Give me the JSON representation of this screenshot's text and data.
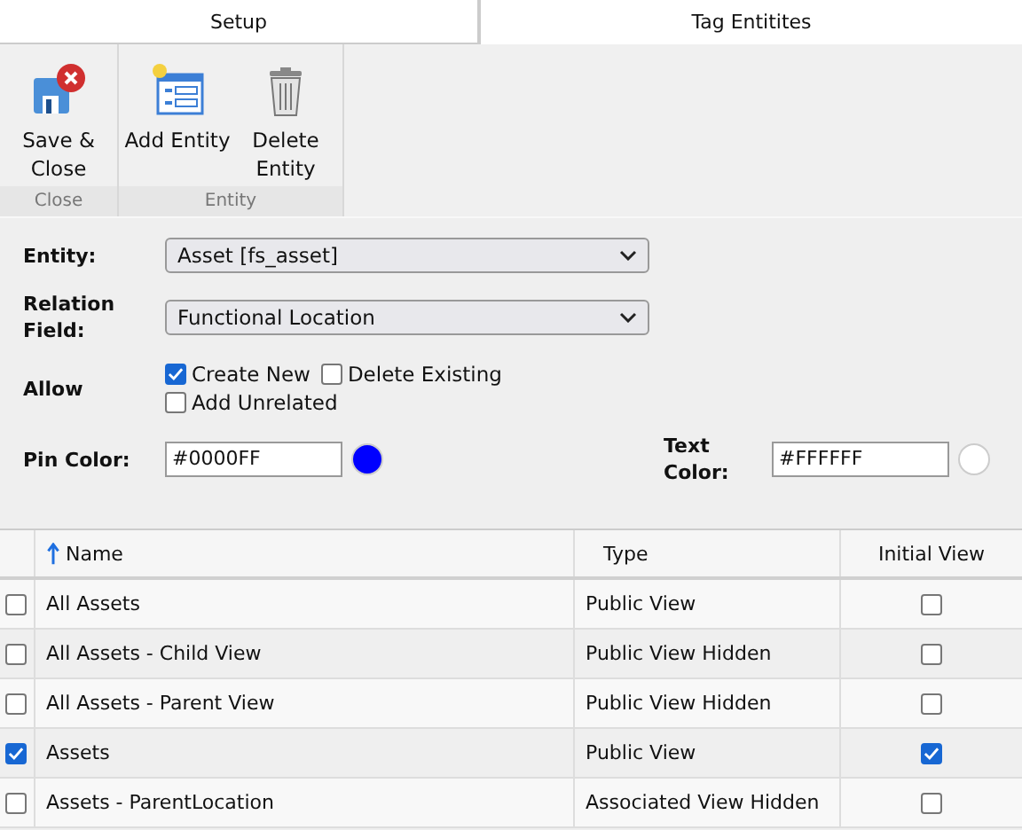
{
  "tabs": [
    {
      "label": "Setup",
      "selected": false
    },
    {
      "label": "Tag Entitites",
      "selected": true
    }
  ],
  "ribbon": {
    "groups": [
      {
        "label": "Close",
        "buttons": [
          {
            "label": "Save & Close",
            "kind": "save-close"
          }
        ]
      },
      {
        "label": "Entity",
        "buttons": [
          {
            "label": "Add Entity",
            "kind": "add"
          },
          {
            "label": "Delete Entity",
            "kind": "delete"
          }
        ]
      }
    ]
  },
  "form": {
    "entity": {
      "label": "Entity:",
      "value": "Asset [fs_asset]"
    },
    "relation_field": {
      "label": "Relation Field:",
      "value": "Functional Location"
    },
    "allow": {
      "label": "Allow",
      "options": [
        {
          "label": "Create New",
          "checked": true
        },
        {
          "label": "Delete Existing",
          "checked": false
        },
        {
          "label": "Add Unrelated",
          "checked": false
        }
      ]
    },
    "pin_color": {
      "label": "Pin Color:",
      "value": "#0000FF",
      "color": "#0000ff"
    },
    "text_color": {
      "label": "Text Color:",
      "value": "#FFFFFF",
      "color": "#ffffff"
    }
  },
  "table": {
    "columns": [
      "Name",
      "Type",
      "Initial View"
    ],
    "rows": [
      {
        "name": "All Assets",
        "type": "Public View",
        "checked": false,
        "initial_view": false
      },
      {
        "name": "All Assets - Child View",
        "type": "Public View Hidden",
        "checked": false,
        "initial_view": false
      },
      {
        "name": "All Assets - Parent View",
        "type": "Public View Hidden",
        "checked": false,
        "initial_view": false
      },
      {
        "name": "Assets",
        "type": "Public View",
        "checked": true,
        "initial_view": true
      },
      {
        "name": "Assets - ParentLocation",
        "type": "Associated View Hidden",
        "checked": false,
        "initial_view": false
      }
    ]
  }
}
